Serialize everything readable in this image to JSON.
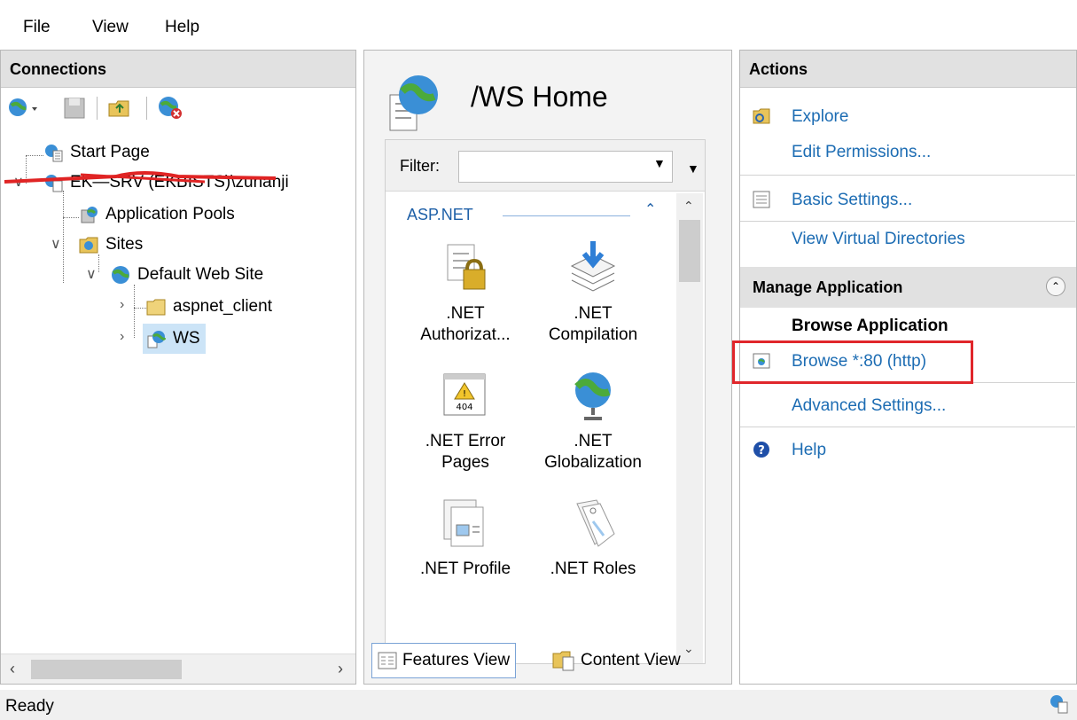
{
  "menu": [
    "File",
    "View",
    "Help"
  ],
  "connections": {
    "title": "Connections",
    "tree": {
      "start_page": "Start Page",
      "server": "EK—SRV (EKBISTS)\\zunanji",
      "app_pools": "Application Pools",
      "sites": "Sites",
      "default_site": "Default Web Site",
      "aspnet_client": "aspnet_client",
      "ws": "WS"
    }
  },
  "center": {
    "title": "/WS Home",
    "filter_label": "Filter:",
    "filter_value": "",
    "group": "ASP.NET",
    "features": [
      {
        "line1": ".NET",
        "line2": "Authorizat..."
      },
      {
        "line1": ".NET",
        "line2": "Compilation"
      },
      {
        "line1": ".NET Error",
        "line2": "Pages"
      },
      {
        "line1": ".NET",
        "line2": "Globalization"
      },
      {
        "line1": ".NET Profile",
        "line2": ""
      },
      {
        "line1": ".NET Roles",
        "line2": ""
      }
    ],
    "tabs": {
      "features_view": "Features View",
      "content_view": "Content View"
    }
  },
  "actions": {
    "title": "Actions",
    "explore": "Explore",
    "edit_permissions": "Edit Permissions...",
    "basic_settings": "Basic Settings...",
    "view_virtual_dirs": "View Virtual Directories",
    "manage_app": "Manage Application",
    "browse_app": "Browse Application",
    "browse_80": "Browse *:80 (http)",
    "advanced_settings": "Advanced Settings...",
    "help": "Help"
  },
  "status": {
    "text": "Ready"
  },
  "colors": {
    "link": "#1c6cb3",
    "highlight": "#e0262b",
    "selected": "#cce4f7"
  }
}
